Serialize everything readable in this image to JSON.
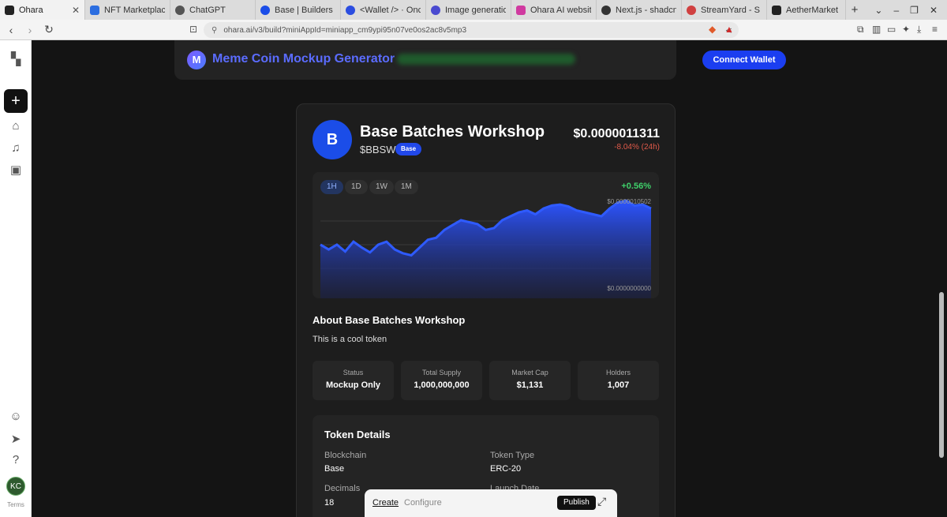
{
  "browser": {
    "tabs": [
      {
        "title": "Ohara",
        "active": true,
        "color": "#222222"
      },
      {
        "title": "NFT Marketplace",
        "active": false,
        "color": "#2b6de0"
      },
      {
        "title": "ChatGPT",
        "active": false,
        "color": "#555555"
      },
      {
        "title": "Base | Builders",
        "active": false,
        "color": "#1b4de8"
      },
      {
        "title": "<Wallet /> · Oncha",
        "active": false,
        "color": "#2b4de0"
      },
      {
        "title": "Image generation",
        "active": false,
        "color": "#4a4ad0"
      },
      {
        "title": "Ohara AI website",
        "active": false,
        "color": "#d03aa0"
      },
      {
        "title": "Next.js - shadcn/ui",
        "active": false,
        "color": "#333333"
      },
      {
        "title": "StreamYard - S",
        "active": false,
        "color": "#d04040"
      },
      {
        "title": "AetherMarket | N",
        "active": false,
        "color": "#222222"
      }
    ],
    "url": "ohara.ai/v3/build?miniAppId=miniapp_cm9ypi95n07ve0os2ac8v5mp3"
  },
  "sidebar": {
    "terms": "Terms",
    "avatar": "KC"
  },
  "header": {
    "logo_letter": "M",
    "title": "Meme Coin Mockup Generator",
    "connect_label": "Connect Wallet"
  },
  "token": {
    "logo_letter": "B",
    "name": "Base Batches Workshop",
    "symbol": "$BBSW",
    "chain_badge": "Base",
    "price": "$0.0000011311",
    "change_24h": "-8.04% (24h)"
  },
  "chart": {
    "timeframes": [
      "1H",
      "1D",
      "1W",
      "1M"
    ],
    "active_timeframe": "1H",
    "change": "+0.56%",
    "max_label": "$0.0000010502",
    "min_label": "$0.0000000000",
    "colors": {
      "line": "#2f5bff",
      "fill_top": "#2c54ff",
      "fill_bottom": "#1a1f44"
    }
  },
  "chart_data": {
    "type": "area",
    "x": [
      0,
      1,
      2,
      3,
      4,
      5,
      6,
      7,
      8,
      9,
      10,
      11,
      12,
      13,
      14,
      15,
      16,
      17,
      18,
      19,
      20,
      21,
      22,
      23,
      24,
      25,
      26,
      27,
      28,
      29,
      30,
      31,
      32,
      33,
      34,
      35,
      36,
      37,
      38,
      39,
      40
    ],
    "values": [
      0.55,
      0.5,
      0.55,
      0.48,
      0.58,
      0.52,
      0.47,
      0.55,
      0.58,
      0.5,
      0.46,
      0.44,
      0.52,
      0.6,
      0.62,
      0.7,
      0.75,
      0.8,
      0.78,
      0.76,
      0.7,
      0.72,
      0.8,
      0.84,
      0.88,
      0.9,
      0.86,
      0.92,
      0.95,
      0.96,
      0.94,
      0.9,
      0.88,
      0.86,
      0.84,
      0.92,
      0.98,
      1.0,
      0.95,
      0.96,
      0.92
    ],
    "ylim": [
      0,
      1.05
    ]
  },
  "about": {
    "title": "About Base Batches Workshop",
    "text": "This is a cool token"
  },
  "stats": [
    {
      "label": "Status",
      "value": "Mockup Only"
    },
    {
      "label": "Total Supply",
      "value": "1,000,000,000"
    },
    {
      "label": "Market Cap",
      "value": "$1,131"
    },
    {
      "label": "Holders",
      "value": "1,007"
    }
  ],
  "details": {
    "title": "Token Details",
    "blockchain_label": "Blockchain",
    "blockchain_value": "Base",
    "type_label": "Token Type",
    "type_value": "ERC-20",
    "decimals_label": "Decimals",
    "decimals_value": "18",
    "launch_label": "Launch Date"
  },
  "bottombar": {
    "create": "Create",
    "configure": "Configure",
    "publish": "Publish"
  }
}
